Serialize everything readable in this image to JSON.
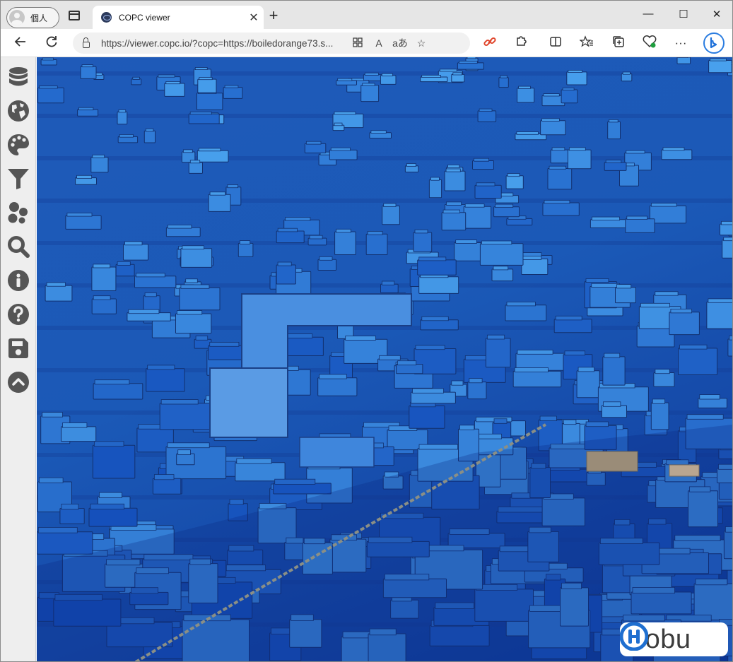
{
  "browser": {
    "profile_label": "個人",
    "tab_title": "COPC viewer",
    "url": "https://viewer.copc.io/?copc=https://boiledorange73.s...",
    "read_aloud_glyph": "A",
    "translate_glyph": "aあ",
    "new_tab_glyph": "+",
    "close_tab_glyph": "✕",
    "minimize_glyph": "—",
    "maximize_glyph": "☐",
    "close_window_glyph": "✕",
    "more_glyph": "···"
  },
  "sidebar": {
    "items": [
      {
        "icon": "database-icon"
      },
      {
        "icon": "globe-icon"
      },
      {
        "icon": "palette-icon"
      },
      {
        "icon": "filter-icon"
      },
      {
        "icon": "cluster-icon"
      },
      {
        "icon": "search-icon"
      },
      {
        "icon": "info-icon"
      },
      {
        "icon": "help-icon"
      },
      {
        "icon": "save-icon"
      },
      {
        "icon": "collapse-icon"
      }
    ]
  },
  "viewer": {
    "logo_text": "hobu"
  },
  "colors": {
    "ground_blue": "#1b59b7",
    "building_blue": "#2f7ad6",
    "icon_gray": "#555555",
    "logo_accent": "#1f6fd0"
  }
}
